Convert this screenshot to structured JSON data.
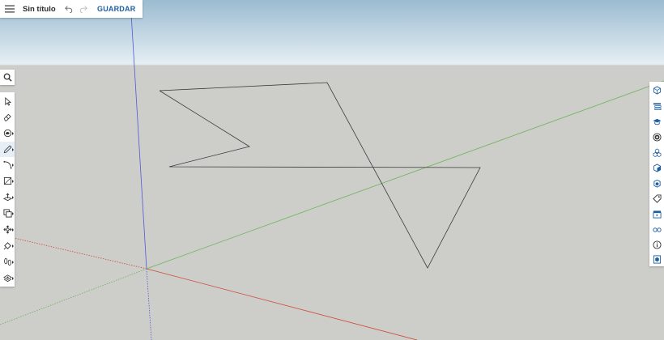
{
  "app": {
    "document_title": "Sin título",
    "save_label": "GUARDAR"
  },
  "colors": {
    "sky_top": "#9bbbd0",
    "sky_bottom": "#e6eff4",
    "ground": "#cdcdca",
    "blue_axis": "#4f5bd5",
    "red_axis": "#d04a3a",
    "green_axis": "#6cb35a",
    "accent": "#1d5fa1"
  },
  "toolbar_icons": [
    "menu-icon",
    "undo-icon",
    "redo-icon"
  ],
  "left_tools": [
    {
      "name": "select-tool",
      "has_submenu": false
    },
    {
      "name": "eraser-tool",
      "has_submenu": false
    },
    {
      "name": "paint-bucket-tool",
      "has_submenu": true
    },
    {
      "name": "line-tool",
      "has_submenu": true,
      "active": true
    },
    {
      "name": "arc-tool",
      "has_submenu": true
    },
    {
      "name": "rectangle-tool",
      "has_submenu": true
    },
    {
      "name": "push-pull-tool",
      "has_submenu": true
    },
    {
      "name": "offset-tool",
      "has_submenu": true
    },
    {
      "name": "move-tool",
      "has_submenu": true
    },
    {
      "name": "tape-measure-tool",
      "has_submenu": true
    },
    {
      "name": "walk-tool",
      "has_submenu": true
    },
    {
      "name": "section-plane-tool",
      "has_submenu": true
    }
  ],
  "right_panels": [
    "entity-info-icon",
    "outliner-icon",
    "instructor-icon",
    "materials-icon",
    "components-icon",
    "styles-icon",
    "tags-icon",
    "scenes-icon",
    "display-icon",
    "model-info-icon",
    "solid-inspector-icon"
  ]
}
